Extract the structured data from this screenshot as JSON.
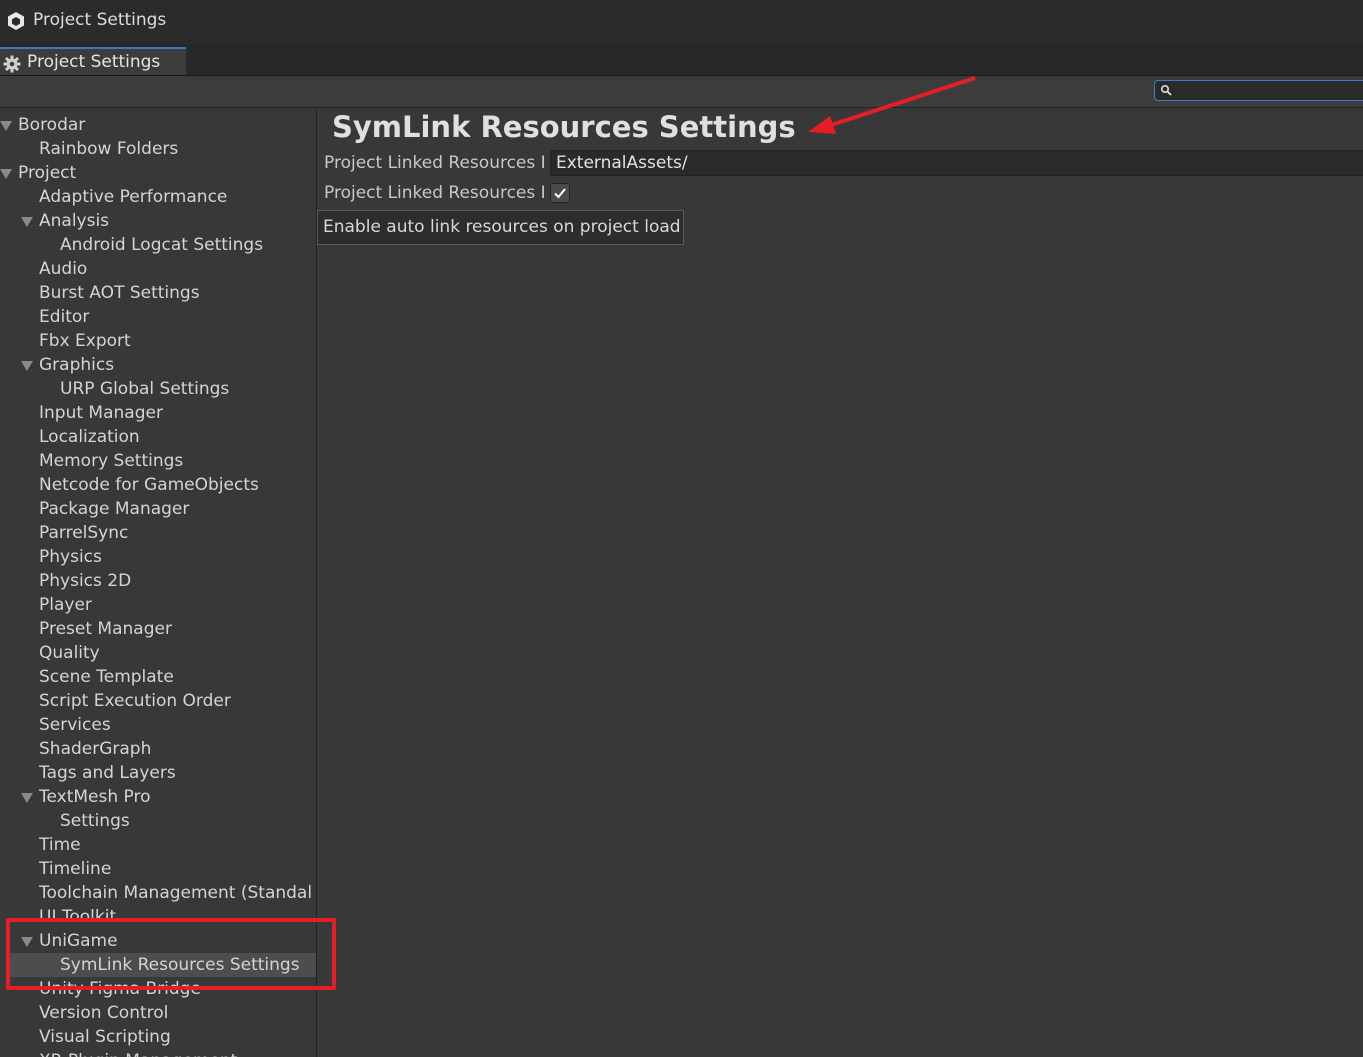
{
  "window": {
    "title": "Project Settings",
    "icon": "unity-logo-icon"
  },
  "tab": {
    "label": "Project Settings",
    "icon": "gear-icon"
  },
  "search": {
    "value": "",
    "placeholder": "",
    "icon": "search-icon",
    "accent": "#3d7bd1"
  },
  "sidebar": {
    "items": [
      {
        "label": "Borodar",
        "expanded": true
      },
      {
        "label": "Rainbow Folders"
      },
      {
        "label": "Project",
        "expanded": true
      },
      {
        "label": "Adaptive Performance"
      },
      {
        "label": "Analysis",
        "expanded": true
      },
      {
        "label": "Android Logcat Settings"
      },
      {
        "label": "Audio"
      },
      {
        "label": "Burst AOT Settings"
      },
      {
        "label": "Editor"
      },
      {
        "label": "Fbx Export"
      },
      {
        "label": "Graphics",
        "expanded": true
      },
      {
        "label": "URP Global Settings"
      },
      {
        "label": "Input Manager"
      },
      {
        "label": "Localization"
      },
      {
        "label": "Memory Settings"
      },
      {
        "label": "Netcode for GameObjects"
      },
      {
        "label": "Package Manager"
      },
      {
        "label": "ParrelSync"
      },
      {
        "label": "Physics"
      },
      {
        "label": "Physics 2D"
      },
      {
        "label": "Player"
      },
      {
        "label": "Preset Manager"
      },
      {
        "label": "Quality"
      },
      {
        "label": "Scene Template"
      },
      {
        "label": "Script Execution Order"
      },
      {
        "label": "Services"
      },
      {
        "label": "ShaderGraph"
      },
      {
        "label": "Tags and Layers"
      },
      {
        "label": "TextMesh Pro",
        "expanded": true
      },
      {
        "label": "Settings"
      },
      {
        "label": "Time"
      },
      {
        "label": "Timeline"
      },
      {
        "label": "Toolchain Management (Standal"
      },
      {
        "label": "UI Toolkit"
      },
      {
        "label": "UniGame",
        "expanded": true
      },
      {
        "label": "SymLink Resources Settings",
        "selected": true
      },
      {
        "label": "Unity Figma Bridge"
      },
      {
        "label": "Version Control"
      },
      {
        "label": "Visual Scripting"
      },
      {
        "label": "XR Plugin Management"
      }
    ]
  },
  "main": {
    "title": "SymLink Resources Settings",
    "fields": [
      {
        "label": "Project Linked Resources I",
        "value": "ExternalAssets/"
      },
      {
        "label": "Project Linked Resources I",
        "checked": true
      }
    ],
    "tooltip": "Enable auto link resources on project load"
  },
  "annotations": {
    "color": "#e41e25"
  }
}
